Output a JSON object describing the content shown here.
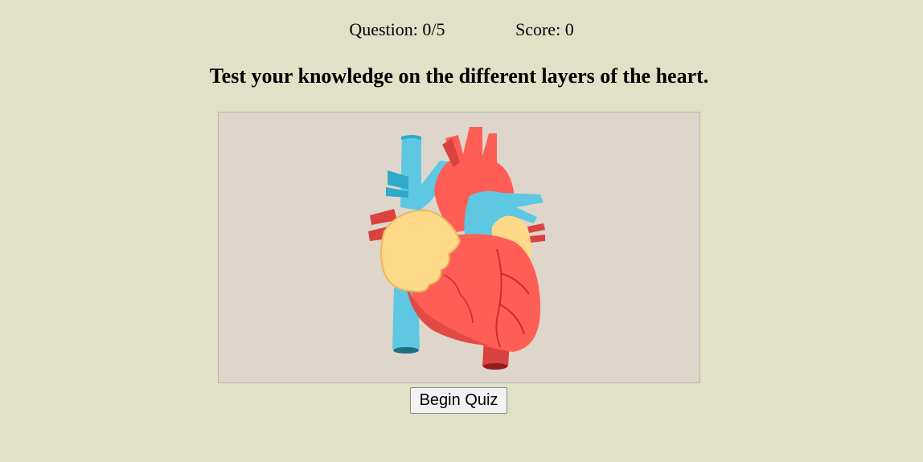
{
  "status": {
    "question_label": "Question: 0/5",
    "score_label": "Score: 0"
  },
  "title": "Test your knowledge on the different layers of the heart.",
  "image": {
    "subject": "heart-illustration",
    "colors": {
      "background": "#ded6ca",
      "vein_blue": "#5ec8e2",
      "vein_blue_dark": "#2ea9c9",
      "artery_red": "#ff5e57",
      "artery_red_dark": "#d9423f",
      "atrium_yellow": "#ffd98a",
      "atrium_outline": "#e8b85c"
    }
  },
  "actions": {
    "begin_label": "Begin Quiz"
  },
  "theme": {
    "page_background": "#e1e1c7"
  }
}
